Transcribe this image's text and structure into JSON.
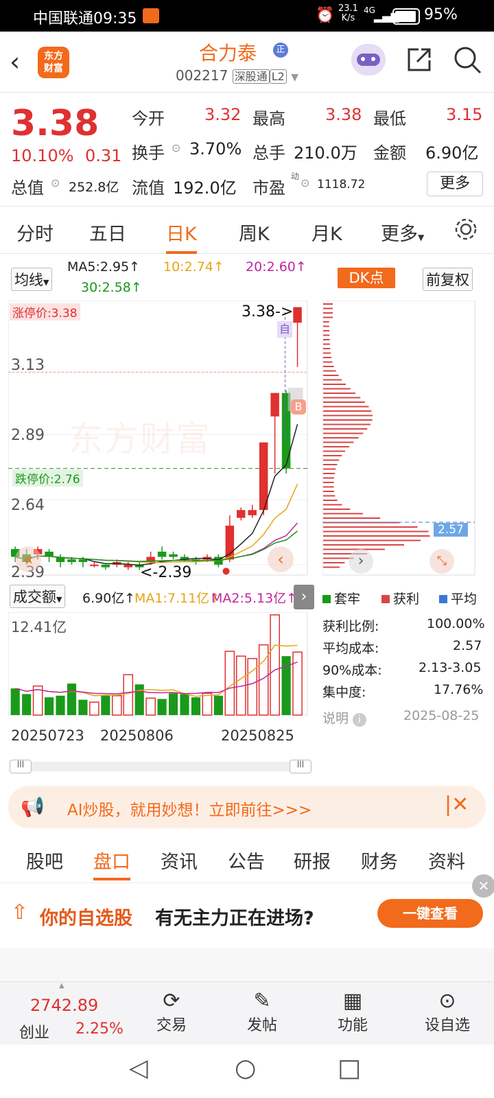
{
  "status_bar": {
    "carrier_time": "中国联通09:35",
    "speed": "23.1",
    "speed_unit": "K/s",
    "signal": "4G",
    "battery": "95%"
  },
  "header": {
    "logo_line1": "东方",
    "logo_line2": "财富",
    "name": "合力泰",
    "badge": "正",
    "code": "002217",
    "tag1": "深股通",
    "tag2": "L2"
  },
  "quote": {
    "price": "3.38",
    "change_pct": "10.10%",
    "change": "0.31",
    "open_label": "今开",
    "open": "3.32",
    "high_label": "最高",
    "high": "3.38",
    "low_label": "最低",
    "low": "3.15",
    "turnover_label": "换手",
    "turnover": "3.70%",
    "volume_label": "总手",
    "volume": "210.0万",
    "amount_label": "金额",
    "amount": "6.90亿",
    "total_cap_label": "总值",
    "total_cap": "252.8亿",
    "float_cap_label": "流值",
    "float_cap": "192.0亿",
    "pe_label": "市盈",
    "pe_sup": "动",
    "pe": "1118.72",
    "more": "更多"
  },
  "kline_tabs": [
    "分时",
    "五日",
    "日K",
    "周K",
    "月K",
    "更多"
  ],
  "active_tab": "日K",
  "ma_bar": {
    "selector": "均线",
    "ma5": "MA5:2.95↑",
    "ma10": "10:2.74↑",
    "ma20": "20:2.60↑",
    "ma30": "30:2.58↑",
    "dk": "DK点",
    "adjust": "前复权"
  },
  "chart_labels": {
    "limit_up": "涨停价:3.38",
    "limit_down": "跌停价:2.76",
    "y1": "3.13",
    "y2": "2.89",
    "y3": "2.64",
    "y4": "2.39",
    "high_mark": "3.38->",
    "low_mark": "<-2.39",
    "watermark": "东方财富",
    "self_tag": "自",
    "buy_tag": "B",
    "cost_tag": "2.57"
  },
  "volume_bar": {
    "selector": "成交额",
    "value": "6.90亿↑",
    "ma1": "MA1:7.11亿↑",
    "ma2": "MA2:5.13亿↑",
    "max": "12.41亿"
  },
  "dates": [
    "20250723",
    "20250806",
    "20250825"
  ],
  "colors": {
    "accent": "#f26a1b",
    "up": "#e03030",
    "down": "#1a9a1a"
  },
  "chart_data": {
    "type": "candlestick",
    "ylim": [
      2.35,
      3.4
    ],
    "candles": [
      {
        "o": 2.45,
        "c": 2.42,
        "h": 2.46,
        "l": 2.4
      },
      {
        "o": 2.43,
        "c": 2.4,
        "h": 2.45,
        "l": 2.39
      },
      {
        "o": 2.43,
        "c": 2.45,
        "h": 2.46,
        "l": 2.41
      },
      {
        "o": 2.44,
        "c": 2.42,
        "h": 2.45,
        "l": 2.4
      },
      {
        "o": 2.42,
        "c": 2.4,
        "h": 2.43,
        "l": 2.38
      },
      {
        "o": 2.41,
        "c": 2.4,
        "h": 2.42,
        "l": 2.39
      },
      {
        "o": 2.41,
        "c": 2.4,
        "h": 2.42,
        "l": 2.38
      },
      {
        "o": 2.39,
        "c": 2.39,
        "h": 2.4,
        "l": 2.38
      },
      {
        "o": 2.39,
        "c": 2.38,
        "h": 2.39,
        "l": 2.37
      },
      {
        "o": 2.39,
        "c": 2.4,
        "h": 2.41,
        "l": 2.38
      },
      {
        "o": 2.38,
        "c": 2.39,
        "h": 2.4,
        "l": 2.37
      },
      {
        "o": 2.39,
        "c": 2.38,
        "h": 2.4,
        "l": 2.37
      },
      {
        "o": 2.4,
        "c": 2.42,
        "h": 2.44,
        "l": 2.39
      },
      {
        "o": 2.44,
        "c": 2.42,
        "h": 2.46,
        "l": 2.41
      },
      {
        "o": 2.43,
        "c": 2.42,
        "h": 2.44,
        "l": 2.41
      },
      {
        "o": 2.42,
        "c": 2.41,
        "h": 2.43,
        "l": 2.4
      },
      {
        "o": 2.41,
        "c": 2.4,
        "h": 2.42,
        "l": 2.39
      },
      {
        "o": 2.41,
        "c": 2.42,
        "h": 2.43,
        "l": 2.4
      },
      {
        "o": 2.42,
        "c": 2.39,
        "h": 2.43,
        "l": 2.38
      },
      {
        "o": 2.41,
        "c": 2.54,
        "h": 2.58,
        "l": 2.4
      },
      {
        "o": 2.57,
        "c": 2.6,
        "h": 2.61,
        "l": 2.56
      },
      {
        "o": 2.58,
        "c": 2.6,
        "h": 2.62,
        "l": 2.57
      },
      {
        "o": 2.6,
        "c": 2.86,
        "h": 2.86,
        "l": 2.58
      },
      {
        "o": 2.96,
        "c": 3.05,
        "h": 3.05,
        "l": 2.74
      },
      {
        "o": 3.05,
        "c": 2.76,
        "h": 3.06,
        "l": 2.74
      },
      {
        "o": 3.32,
        "c": 3.38,
        "h": 3.38,
        "l": 3.15
      }
    ],
    "volume_ylim": [
      0,
      12.41
    ],
    "volume": [
      3.3,
      2.6,
      3.6,
      2.2,
      2.4,
      3.9,
      1.9,
      1.6,
      2.5,
      2.4,
      5.0,
      3.8,
      2.1,
      2.0,
      2.7,
      2.6,
      2.2,
      2.7,
      2.4,
      7.9,
      7.3,
      7.0,
      8.7,
      12.41,
      7.3,
      7.8
    ],
    "cost_distribution": {
      "profit_ratio": "100.00%",
      "avg_cost": "2.57",
      "cost90": "2.13-3.05",
      "concentration": "17.76%"
    }
  },
  "cost_panel": {
    "legend_trapped": "套牢",
    "legend_profit": "获利",
    "legend_avg": "平均",
    "profit_ratio_label": "获利比例:",
    "avg_cost_label": "平均成本:",
    "cost90_label": "90%成本:",
    "concentration_label": "集中度:",
    "note": "说明",
    "date": "2025-08-25"
  },
  "banner": {
    "text": "AI炒股，就用妙想！立即前往>>>"
  },
  "bottom_tabs": [
    "股吧",
    "盘口",
    "资讯",
    "公告",
    "研报",
    "财务",
    "资料"
  ],
  "bottom_active": "盘口",
  "promo": {
    "highlight": "你的自选股",
    "text": "有无主力正在进场?",
    "button": "一键查看"
  },
  "bottom_nav": {
    "index_value": "2742.89",
    "index_name": "创业",
    "index_pct": "2.25%",
    "trade": "交易",
    "post": "发帖",
    "features": "功能",
    "add_watch": "设自选"
  }
}
